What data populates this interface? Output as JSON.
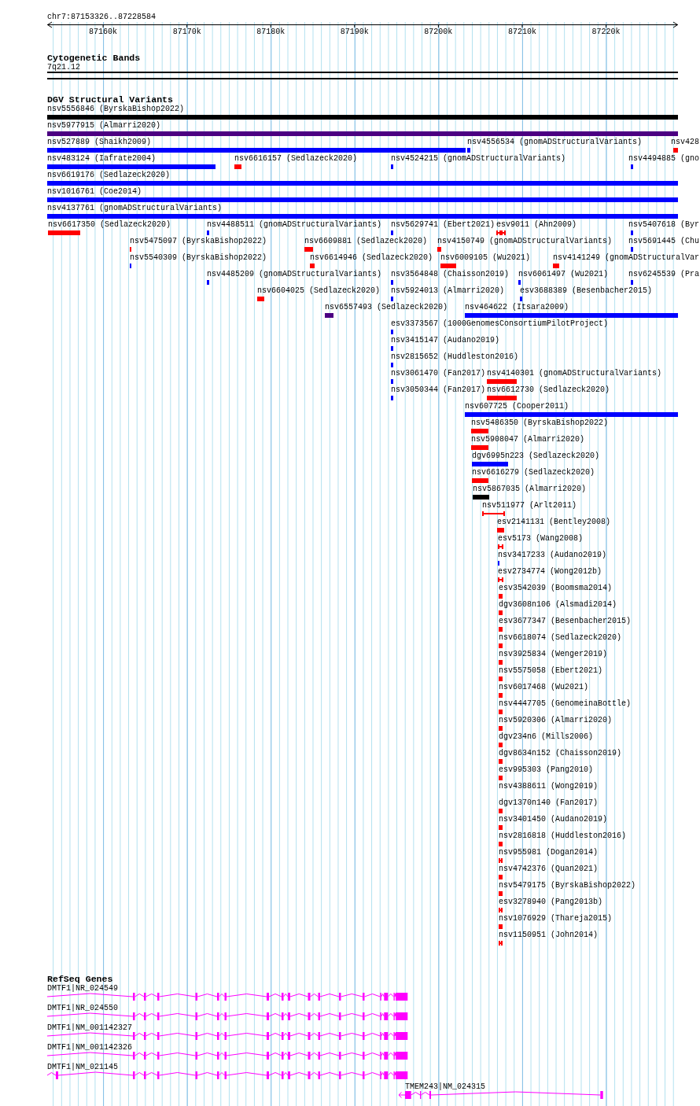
{
  "ruler": {
    "range": "chr7:87153326..87228584",
    "ticks": [
      "87160k",
      "87170k",
      "87180k",
      "87190k",
      "87200k",
      "87210k",
      "87220k"
    ]
  },
  "tracks": [
    {
      "kind": "bands",
      "title": "Cytogenetic Bands",
      "bands": [
        {
          "label": "7q21.12"
        }
      ]
    },
    {
      "kind": "variants",
      "title": "DGV Structural Variants",
      "rows": [
        {
          "features": [
            {
              "label": "nsv5556846 (ByrskaBishop2022)",
              "kind": "box",
              "color": "#000000"
            }
          ]
        },
        {
          "features": [
            {
              "label": "nsv5977915 (Almarri2020)",
              "kind": "box",
              "color": "#4b0082"
            }
          ]
        },
        {
          "features": [
            {
              "label": "nsv527889 (Shaikh2009)",
              "kind": "box",
              "color": "#0000ff"
            },
            {
              "label": "nsv4556534 (gnomADStructuralVariants)",
              "kind": "box",
              "color": "#0000ff"
            },
            {
              "label": "nsv428",
              "kind": "box",
              "color": "#ff0000"
            }
          ]
        },
        {
          "features": [
            {
              "label": "nsv483124 (Iafrate2004)",
              "kind": "box",
              "color": "#0000ff"
            },
            {
              "label": "nsv6616157 (Sedlazeck2020)",
              "kind": "box",
              "color": "#ff0000"
            },
            {
              "label": "nsv4524215 (gnomADStructuralVariants)",
              "kind": "box",
              "color": "#0000ff"
            },
            {
              "label": "nsv4494885 (gno",
              "kind": "box",
              "color": "#0000ff"
            }
          ]
        },
        {
          "features": [
            {
              "label": "nsv6619176 (Sedlazeck2020)",
              "kind": "box",
              "color": "#0000ff"
            }
          ]
        },
        {
          "features": [
            {
              "label": "nsv1016761 (Coe2014)",
              "kind": "box",
              "color": "#0000ff"
            }
          ]
        },
        {
          "features": [
            {
              "label": "nsv4137761 (gnomADStructuralVariants)",
              "kind": "box",
              "color": "#0000ff"
            }
          ]
        },
        {
          "features": [
            {
              "label": "nsv6617350 (Sedlazeck2020)",
              "kind": "box",
              "color": "#ff0000"
            },
            {
              "label": "nsv4488511 (gnomADStructuralVariants)",
              "kind": "box",
              "color": "#0000ff"
            },
            {
              "label": "nsv5629741 (Ebert2021)",
              "kind": "box",
              "color": "#0000ff"
            },
            {
              "label": "esv9011 (Ahn2009)",
              "kind": "double_capped",
              "color": "#ff0000"
            },
            {
              "label": "nsv5407618 (Byr",
              "kind": "box",
              "color": "#0000ff"
            }
          ]
        },
        {
          "features": [
            {
              "label": "nsv5475097 (ByrskaBishop2022)",
              "kind": "box",
              "color": "#ff0000"
            },
            {
              "label": "nsv6609881 (Sedlazeck2020)",
              "kind": "box",
              "color": "#ff0000"
            },
            {
              "label": "nsv4150749 (gnomADStructuralVariants)",
              "kind": "box",
              "color": "#ff0000"
            },
            {
              "label": "nsv5691445 (Chu",
              "kind": "box",
              "color": "#0000ff"
            }
          ]
        },
        {
          "features": [
            {
              "label": "nsv5540309 (ByrskaBishop2022)",
              "kind": "box",
              "color": "#0000ff"
            },
            {
              "label": "nsv6614946 (Sedlazeck2020)",
              "kind": "box",
              "color": "#ff0000"
            },
            {
              "label": "nsv6009105 (Wu2021)",
              "kind": "box",
              "color": "#ff0000"
            },
            {
              "label": "nsv4141249 (gnomADStructuralVar",
              "kind": "box",
              "color": "#ff0000"
            }
          ]
        },
        {
          "features": [
            {
              "label": "nsv4485209 (gnomADStructuralVariants)",
              "kind": "box",
              "color": "#0000ff"
            },
            {
              "label": "nsv3564848 (Chaisson2019)",
              "kind": "box",
              "color": "#0000ff"
            },
            {
              "label": "nsv6061497 (Wu2021)",
              "kind": "box",
              "color": "#0000ff"
            },
            {
              "label": "nsv6245539 (Pra",
              "kind": "box",
              "color": "#0000ff"
            }
          ]
        },
        {
          "features": [
            {
              "label": "nsv6604025 (Sedlazeck2020)",
              "kind": "box",
              "color": "#ff0000"
            },
            {
              "label": "nsv5924013 (Almarri2020)",
              "kind": "box",
              "color": "#0000ff"
            },
            {
              "label": "esv3688389 (Besenbacher2015)",
              "kind": "box",
              "color": "#0000ff"
            }
          ]
        },
        {
          "features": [
            {
              "label": "nsv6557493 (Sedlazeck2020)",
              "kind": "box",
              "color": "#4b0082"
            },
            {
              "label": "nsv464622 (Itsara2009)",
              "kind": "box",
              "color": "#0000ff"
            }
          ]
        },
        {
          "features": [
            {
              "label": "esv3373567 (1000GenomesConsortiumPilotProject)",
              "kind": "box",
              "color": "#0000ff"
            }
          ]
        },
        {
          "features": [
            {
              "label": "nsv3415147 (Audano2019)",
              "kind": "box",
              "color": "#0000ff"
            }
          ]
        },
        {
          "features": [
            {
              "label": "nsv2815652 (Huddleston2016)",
              "kind": "box",
              "color": "#0000ff"
            }
          ]
        },
        {
          "features": [
            {
              "label": "nsv3061470 (Fan2017)",
              "kind": "box",
              "color": "#0000ff"
            },
            {
              "label": "nsv4140301 (gnomADStructuralVariants)",
              "kind": "box",
              "color": "#ff0000"
            }
          ]
        },
        {
          "features": [
            {
              "label": "nsv3050344 (Fan2017)",
              "kind": "box",
              "color": "#0000ff"
            },
            {
              "label": "nsv6612730 (Sedlazeck2020)",
              "kind": "box",
              "color": "#ff0000"
            }
          ]
        },
        {
          "features": [
            {
              "label": "nsv607725 (Cooper2011)",
              "kind": "box",
              "color": "#0000ff"
            }
          ]
        },
        {
          "features": [
            {
              "label": "nsv5486350 (ByrskaBishop2022)",
              "kind": "box",
              "color": "#ff0000"
            }
          ]
        },
        {
          "features": [
            {
              "label": "nsv5908047 (Almarri2020)",
              "kind": "box",
              "color": "#ff0000"
            }
          ]
        },
        {
          "features": [
            {
              "label": "dgv6995n223 (Sedlazeck2020)",
              "kind": "box",
              "color": "#0000ff"
            }
          ]
        },
        {
          "features": [
            {
              "label": "nsv6616279 (Sedlazeck2020)",
              "kind": "box",
              "color": "#ff0000"
            }
          ]
        },
        {
          "features": [
            {
              "label": "nsv5867035 (Almarri2020)",
              "kind": "box",
              "color": "#000000"
            }
          ]
        },
        {
          "features": [
            {
              "label": "nsv511977 (Arlt2011)",
              "kind": "line_capped",
              "color": "#ff0000"
            }
          ]
        },
        {
          "features": [
            {
              "label": "esv2141131 (Bentley2008)",
              "kind": "box_capped",
              "color": "#ff0000"
            }
          ]
        },
        {
          "features": [
            {
              "label": "esv5173 (Wang2008)",
              "kind": "capped",
              "color": "#ff0000"
            }
          ]
        },
        {
          "features": [
            {
              "label": "nsv3417233 (Audano2019)",
              "kind": "box",
              "color": "#0000ff"
            }
          ]
        },
        {
          "features": [
            {
              "label": "esv2734774 (Wong2012b)",
              "kind": "capped",
              "color": "#ff0000"
            }
          ]
        },
        {
          "features": [
            {
              "label": "esv3542039 (Boomsma2014)",
              "kind": "box",
              "color": "#ff0000"
            }
          ]
        },
        {
          "features": [
            {
              "label": "dgv3608n106 (Alsmadi2014)",
              "kind": "box",
              "color": "#ff0000"
            }
          ]
        },
        {
          "features": [
            {
              "label": "esv3677347 (Besenbacher2015)",
              "kind": "box",
              "color": "#ff0000"
            }
          ]
        },
        {
          "features": [
            {
              "label": "nsv6618074 (Sedlazeck2020)",
              "kind": "box",
              "color": "#ff0000"
            }
          ]
        },
        {
          "features": [
            {
              "label": "nsv3925834 (Wenger2019)",
              "kind": "box",
              "color": "#ff0000"
            }
          ]
        },
        {
          "features": [
            {
              "label": "nsv5575058 (Ebert2021)",
              "kind": "box",
              "color": "#ff0000"
            }
          ]
        },
        {
          "features": [
            {
              "label": "nsv6017468 (Wu2021)",
              "kind": "box",
              "color": "#ff0000"
            }
          ]
        },
        {
          "features": [
            {
              "label": "nsv4447705 (GenomeinaBottle)",
              "kind": "box",
              "color": "#ff0000"
            }
          ]
        },
        {
          "features": [
            {
              "label": "nsv5920306 (Almarri2020)",
              "kind": "box",
              "color": "#ff0000"
            }
          ]
        },
        {
          "features": [
            {
              "label": "dgv234n6 (Mills2006)",
              "kind": "box",
              "color": "#ff0000"
            }
          ]
        },
        {
          "features": [
            {
              "label": "dgv8634n152 (Chaisson2019)",
              "kind": "box",
              "color": "#ff0000"
            }
          ]
        },
        {
          "features": [
            {
              "label": "esv995303 (Pang2010)",
              "kind": "box",
              "color": "#ff0000"
            }
          ]
        },
        {
          "features": [
            {
              "label": "nsv4388611 (Wong2019)",
              "kind": "unmarked"
            }
          ]
        },
        {
          "features": [
            {
              "label": "dgv1370n140 (Fan2017)",
              "kind": "box",
              "color": "#ff0000"
            }
          ]
        },
        {
          "features": [
            {
              "label": "nsv3401450 (Audano2019)",
              "kind": "box",
              "color": "#ff0000"
            }
          ]
        },
        {
          "features": [
            {
              "label": "nsv2816818 (Huddleston2016)",
              "kind": "box",
              "color": "#ff0000"
            }
          ]
        },
        {
          "features": [
            {
              "label": "nsv955981 (Dogan2014)",
              "kind": "capped",
              "color": "#ff0000"
            }
          ]
        },
        {
          "features": [
            {
              "label": "nsv4742376 (Quan2021)",
              "kind": "box",
              "color": "#ff0000"
            }
          ]
        },
        {
          "features": [
            {
              "label": "nsv5479175 (ByrskaBishop2022)",
              "kind": "box",
              "color": "#ff0000"
            }
          ]
        },
        {
          "features": [
            {
              "label": "esv3278940 (Pang2013b)",
              "kind": "capped",
              "color": "#ff0000"
            }
          ]
        },
        {
          "features": [
            {
              "label": "nsv1076929 (Thareja2015)",
              "kind": "box",
              "color": "#ff0000"
            }
          ]
        },
        {
          "features": [
            {
              "label": "nsv1150951 (John2014)",
              "kind": "capped",
              "color": "#ff0000"
            }
          ]
        }
      ]
    },
    {
      "kind": "genes",
      "title": "RefSeq Genes",
      "genes": [
        {
          "label": "DMTF1|NR_024549",
          "arrow": false
        },
        {
          "label": "DMTF1|NR_024550",
          "arrow": false
        },
        {
          "label": "DMTF1|NM_001142327",
          "arrow": false
        },
        {
          "label": "DMTF1|NM_001142326",
          "arrow": false
        },
        {
          "label": "DMTF1|NM_021145",
          "arrow": false
        },
        {
          "label": "TMEM243|NM_024315",
          "arrow": true
        }
      ]
    }
  ]
}
